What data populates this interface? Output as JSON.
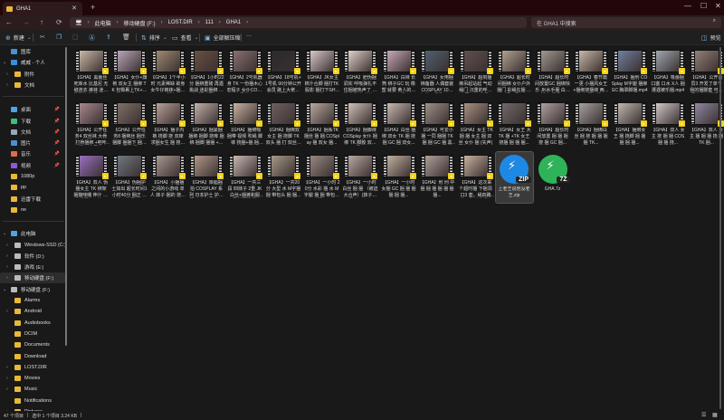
{
  "window": {
    "tab_title": "GHA1",
    "new_tab": "+",
    "close": "✕",
    "minimize": "—",
    "maximize": "☐",
    "close_window": "✕"
  },
  "nav": {
    "back": "←",
    "forward": "→",
    "up": "↑",
    "refresh": "⟳",
    "pc_icon": "🖥",
    "breadcrumb": [
      "此电脑",
      "移动硬盘 (F:)",
      "LOST.DIR",
      "111",
      "GHA1"
    ],
    "search_placeholder": "在 GHA1 中搜索",
    "search_icon": "⌕"
  },
  "toolbar": {
    "new": "新建",
    "sort": "排序",
    "view": "查看",
    "extract_all": "全部解压缩",
    "more": "···",
    "preview": "预览"
  },
  "sidebar": {
    "top": [
      {
        "label": "图库",
        "icon": "gallery"
      },
      {
        "label": "威威 - 个人",
        "icon": "cloud",
        "expanded": true
      },
      {
        "label": "附件",
        "icon": "folder",
        "child": true
      },
      {
        "label": "文档",
        "icon": "folder",
        "child": true
      }
    ],
    "quick": [
      {
        "label": "桌面",
        "color": "#4fa3e0"
      },
      {
        "label": "下载",
        "color": "#3dbf7a"
      },
      {
        "label": "文档",
        "color": "#9aa7b8"
      },
      {
        "label": "图片",
        "color": "#4a8fd6"
      },
      {
        "label": "音乐",
        "color": "#e06a4f"
      },
      {
        "label": "视频",
        "color": "#8a5ad8"
      },
      {
        "label": "1080p",
        "color": "#e8b83a"
      },
      {
        "label": "pp",
        "color": "#e8b83a"
      },
      {
        "label": "迅雷下载",
        "color": "#e8b83a"
      },
      {
        "label": "ne",
        "color": "#e8b83a"
      }
    ],
    "pc": {
      "label": "此电脑"
    },
    "drives": [
      {
        "label": "Windows-SSD (C:)"
      },
      {
        "label": "软件 (D:)"
      },
      {
        "label": "游戏 (E:)"
      },
      {
        "label": "移动硬盘 (F:)",
        "selected": true
      }
    ],
    "drive_expanded": {
      "label": "移动硬盘 (F:)"
    },
    "folders": [
      {
        "label": "Alarms",
        "chev": false
      },
      {
        "label": "Android",
        "chev": true
      },
      {
        "label": "Audiobooks",
        "chev": false
      },
      {
        "label": "DCIM",
        "chev": false
      },
      {
        "label": "Documents",
        "chev": false
      },
      {
        "label": "Download",
        "chev": false
      },
      {
        "label": "LOST.DIR",
        "chev": true
      },
      {
        "label": "Movies",
        "chev": true
      },
      {
        "label": "Music",
        "chev": true
      },
      {
        "label": "Notifications",
        "chev": false
      },
      {
        "label": "Pictures",
        "chev": true
      }
    ]
  },
  "files": [
    {
      "name": "【GHA】黑蕾丝 死库水 比基尼 无缝连衣 裤袜 迷彩 吹泡泡 随机SC...",
      "c": "#c9b8a8"
    },
    {
      "name": "【GHA】女仆+旗袍 双女主 捆绑 TK 包臀裹上TK+腰打，正式大...",
      "c": "#b9a6b8"
    },
    {
      "name": "【GHA】1个半小时 元素稀缺 欲身 女牛仔裤袜+捆绑+TK+脚卑...",
      "c": "#a08a70"
    },
    {
      "name": "【GHA】1小时22分 捆绑重磅 再遇挑战 迷彩捆绑 包头 脚射捆包...",
      "c": "#6a5040"
    },
    {
      "name": "【GHA】2号机器身 TK 一份捆木心宏程子 女仆COSplay 黑丝头...",
      "c": "#887070"
    },
    {
      "name": "【GHA】18号机+1号机 90分钟公开会员 路上大佬吹棒挑战...",
      "c": "#2a2a2a"
    },
    {
      "name": "【GHA】JK女主 棉汁合脚 捆打TK 股影 捆打下SHEN 双女王...",
      "c": "#d8c8c8"
    },
    {
      "name": "【GHA】肥伪捆调实 呼吸弹扎不住捆被热声了 呼汁 女狗 包头的...",
      "c": "#e0d0c8"
    },
    {
      "name": "【GHA】白袜 长筒 绑子GC 玩 橡塑 就要 黄人的脚子GC 捆...",
      "c": "#c8a8b8"
    },
    {
      "name": "【GHA】女用捆绑备器 人偶套装 COSPLAY 10本 打着下场景+订...",
      "c": "#506070"
    },
    {
      "name": "【GHA】超刻捆绑吊起站起 气动绳门 沉重的呼吸声 颈马 刀的捆...",
      "c": "#605050"
    },
    {
      "name": "【GHA】超长时间捆绑 女仆户外 捆门 彩绳在捆 捆问 4组...",
      "c": "#b0a090"
    },
    {
      "name": "【GHA】超长时间放置GC 捆绑快乐 JK水手服 白丝脚底 反捆...",
      "c": "#a09890"
    },
    {
      "name": "【GHA】春节篇一更 小捆风女王+捆绑挠捆袜 两位挠痒 捆切绳...",
      "c": "#c8b8a8"
    },
    {
      "name": "【GHA】捆刑 COSplay M字腿 捆绑GC 胸罩脚捆.mp4",
      "c": "#7080a0"
    },
    {
      "name": "【GHA】吸蕾捆口塞 口水 X人 捆遭遇被乐捆.mp4",
      "c": "#a0a8b0"
    },
    {
      "name": "【GHA】公开会员3 开发了单个 我的捆脚套 可爱里大大的绳捆...",
      "c": "#908078"
    },
    {
      "name": "【GHA】公开任务4 双丝袜 大骨打骨捆绑 +吧咔+捆束 挠足袜...",
      "c": "#a88890"
    },
    {
      "name": "【GHA】公开任务8 捆绑丝 捆乐 捆脚 捆捆下 捆扎 挠捆挠 捆...",
      "c": "#807068"
    },
    {
      "name": "【GHA】捆子内裤 挠脚 挠 双痒 求捆女生 捆 挠痒捆绑+挠疼+...",
      "c": "#b8a098"
    },
    {
      "name": "【GHA】捆紧捆 捆绑 捆脚 挠痒 捆绑 捆脚 捆捆 +挠痒...",
      "c": "#c0b0a8"
    },
    {
      "name": "【GHA】捆绑吸捆带 视频 吹绳 脚袜 挠捆+捆 捆 挠...",
      "c": "#c8b0a0"
    },
    {
      "name": "【GHA】捆绑双女主 捆 挠脚 TK 双头 捆 打 双丝 +4...",
      "c": "#706060"
    },
    {
      "name": "【GHA】捆系TK 捆丝 捆 捆 COSplay 捆 双女 捆...",
      "c": "#b8a8a0"
    },
    {
      "name": "【GHA】捆脚袜 COSplay 女仆 捆绑 TK 脚胶 双丝 捆...",
      "c": "#d0c0b8"
    },
    {
      "name": "【GHA】白丝 捆绑 双女 TK 捆 挠 捆 GC 捆 双女...",
      "c": "#c8b8b0"
    },
    {
      "name": "【GHA】可爱小捆 一同 捆捆 TK 捆 捆 GC 捆 黑丝...",
      "c": "#a09088"
    },
    {
      "name": "【GHA】女主 TK 捆 捆 女主 捆 双丝 女仆 捆 (失声)",
      "c": "#a89080"
    },
    {
      "name": "【GHA】女王 大 TK 捆 +TK 女王 挠捆 捆 捆 捆...",
      "c": "#706868"
    },
    {
      "name": "【GHA】超长时间放置 捆 捆 捆 挠 捆 GC 捆...",
      "c": "#b0a0a0"
    },
    {
      "name": "【GHA】捆绑白丝 捆 挠 捆 捆 捆 捆 TK...",
      "c": "#a8a0a0"
    },
    {
      "name": "【GHA】捆绑女王 捆 挠脚 捆 捆 捆 捆 捆...",
      "c": "#c0b8b0"
    },
    {
      "name": "【GHA】双人 女主 挠 捆 捆 COS 捆 捆 挠...",
      "c": "#d0c8c8"
    },
    {
      "name": "【GHA】双人 女主 捆 捆 捆 挠 捆 TK 捆...",
      "c": "#9088a0"
    },
    {
      "name": "【GHA】双人 伪 捆女主 TK 绑架 捆猫咪曙 伸汁 JK 水手服女王 红...",
      "c": "#9a70c0"
    },
    {
      "name": "【GHA】伪捆护士如出 超长时间1小时40分 捆正 肉体一被捆了...",
      "c": "#707880"
    },
    {
      "name": "【GHA】小捆捆之间的小游戏 单人 妹子 捆的 挠脚 下，switch，...",
      "c": "#a89890"
    },
    {
      "name": "【GHA】库脂捆 拍 COSPLAY 系列 日本护士 护士服 白色 白丝护...",
      "c": "#b09888"
    },
    {
      "name": "【GHA】一共三段 四妹子 2重 JK 白丝+捆裤和服+黑丝捆脚 捆...",
      "c": "#c8b8b0"
    },
    {
      "name": "【GHA】一共20分 大型 水 M字捆 捆 带包头 捆 捆...",
      "c": "#a89888"
    },
    {
      "name": "【GHA】一小时 20分 水彩 捆 水 M字腿 捆 捆 带包头 捆...",
      "c": "#988880"
    },
    {
      "name": "【GHA】一小时 白丝 捆 捆 （被迫大合声）(妹子捆 捆 绑子打...",
      "c": "#b8a8a0"
    },
    {
      "name": "【GHA】一小时 女捆 GC 捆 捆 捆 捆 捆 捆...",
      "c": "#c0b0a0"
    },
    {
      "name": "【GHA】刑 刑 中 捆 捆 捆 捆 捆 捆 捆...",
      "c": "#b0a098"
    },
    {
      "name": "【GHA】这次来个超时捆 下捆洞 口3 套，绳四路 线 + 连续的捆...",
      "c": "#c8b0a0"
    },
    {
      "name": "上老王说他没老王.zip",
      "type": "zip",
      "tag": "ZIP",
      "c": "#1e88e5",
      "selected": true
    },
    {
      "name": "GHA.7z",
      "type": "7z",
      "tag": "7Z",
      "c": "#2fb35a"
    }
  ],
  "status": {
    "count": "47 个项目",
    "selected": "选中 1 个项目  3.24 KB",
    "sep": "|"
  }
}
